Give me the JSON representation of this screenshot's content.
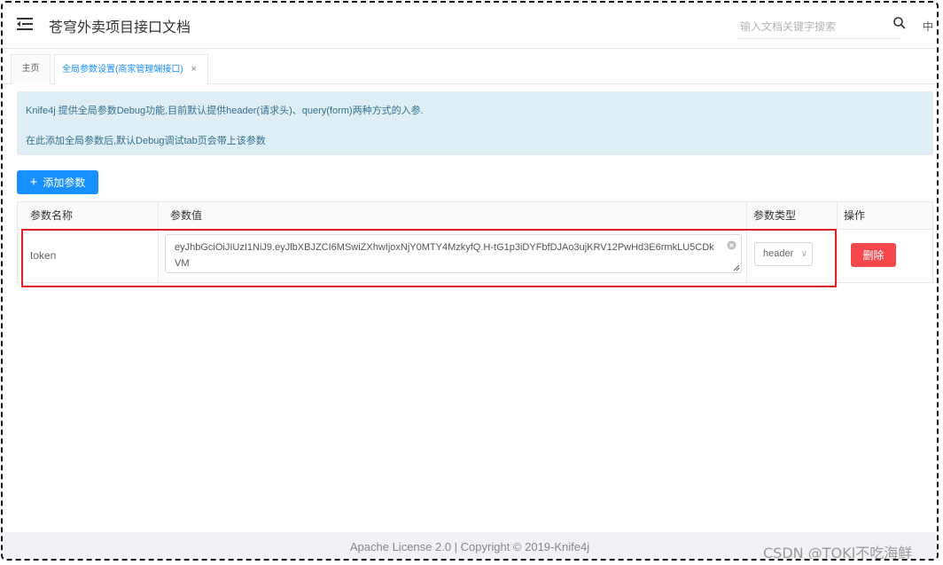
{
  "app": {
    "title": "苍穹外卖项目接口文档"
  },
  "search": {
    "placeholder": "输入文档关键字搜索"
  },
  "lang": {
    "label": "中"
  },
  "tabs": [
    {
      "label": "主页",
      "active": false
    },
    {
      "label": "全局参数设置(商家管理端接口)",
      "active": true,
      "close": "×"
    }
  ],
  "notice": {
    "line1": "Knife4j 提供全局参数Debug功能,目前默认提供header(请求头)、query(form)两种方式的入参.",
    "line2": "在此添加全局参数后,默认Debug调试tab页会带上该参数"
  },
  "toolbar": {
    "add_label": "添加参数",
    "add_icon": "plus-icon"
  },
  "table": {
    "headers": [
      "参数名称",
      "参数值",
      "参数类型",
      "操作"
    ],
    "rows": [
      {
        "name": "token",
        "value": "eyJhbGciOiJIUzI1NiJ9.eyJlbXBJZCI6MSwiZXhwIjoxNjY0MTY4MzkyfQ.H-tG1p3iDYFbfDJAo3ujKRV12PwHd3E6rmkLU5CDkVM",
        "type": "header",
        "action": "删除"
      }
    ]
  },
  "colors": {
    "primary": "#1890ff",
    "danger": "#f5484c",
    "highlight": "#e11d25",
    "notice_bg": "#dfeef5"
  },
  "footer": {
    "text": "Apache License 2.0 | Copyright © 2019-Knife4j"
  },
  "watermark": {
    "text": "CSDN @TOKI不吃海鲜"
  }
}
